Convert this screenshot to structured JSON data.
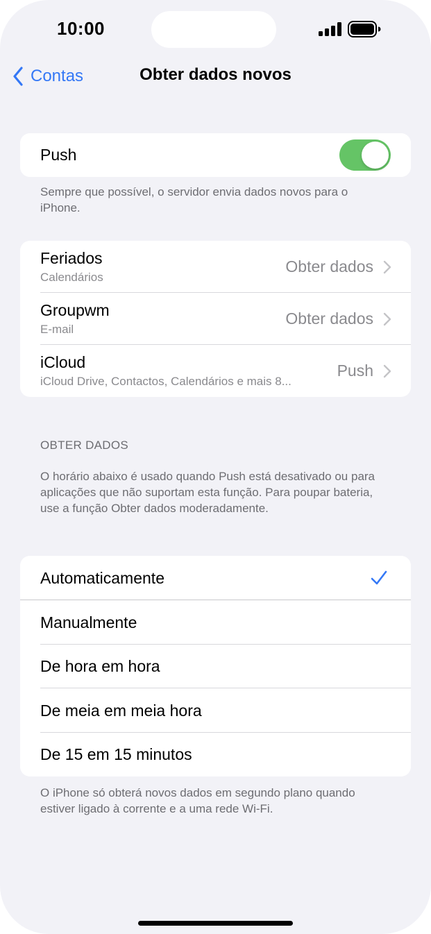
{
  "status_bar": {
    "time": "10:00"
  },
  "nav": {
    "back_label": "Contas",
    "title": "Obter dados novos"
  },
  "push": {
    "label": "Push",
    "enabled": true,
    "footer": "Sempre que possível, o servidor envia dados novos para o iPhone."
  },
  "accounts": [
    {
      "name": "Feriados",
      "detail": "Calendários",
      "mode": "Obter dados"
    },
    {
      "name": "Groupwm",
      "detail": "E-mail",
      "mode": "Obter dados"
    },
    {
      "name": "iCloud",
      "detail": "iCloud Drive, Contactos, Calendários e mais 8...",
      "mode": "Push"
    }
  ],
  "fetch_section": {
    "header": "OBTER DADOS",
    "description": "O horário abaixo é usado quando Push está desativado ou para aplicações que não suportam esta função. Para poupar bateria, use a função Obter dados moderadamente.",
    "options": [
      {
        "label": "Automaticamente",
        "selected": true
      },
      {
        "label": "Manualmente",
        "selected": false
      },
      {
        "label": "De hora em hora",
        "selected": false
      },
      {
        "label": "De meia em meia hora",
        "selected": false
      },
      {
        "label": "De 15 em 15 minutos",
        "selected": false
      }
    ],
    "footer": "O iPhone só obterá novos dados em segundo plano quando estiver ligado à corrente e a uma rede Wi-Fi."
  },
  "colors": {
    "accent": "#3478f6",
    "toggle_on": "#65c466",
    "background": "#f2f2f7"
  }
}
